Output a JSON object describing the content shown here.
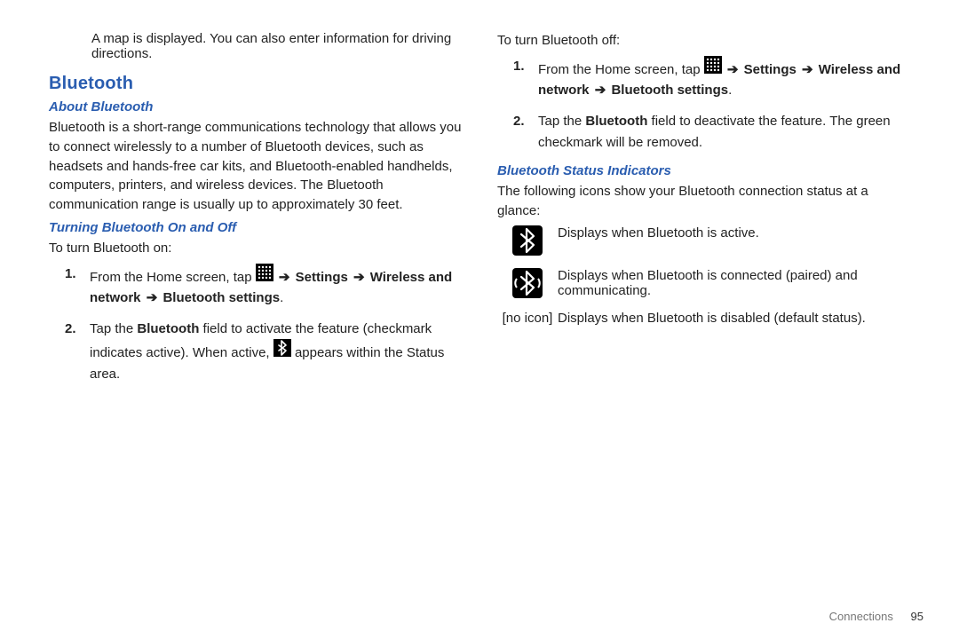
{
  "left": {
    "intro": "A map is displayed. You can also enter information for driving directions.",
    "h1": "Bluetooth",
    "about_head": "About Bluetooth",
    "about_body": "Bluetooth is a short-range communications technology that allows you to connect wirelessly to a number of Bluetooth devices, such as headsets and hands-free car kits, and Bluetooth-enabled handhelds, computers, printers, and wireless devices. The Bluetooth communication range is usually up to approximately 30 feet.",
    "toggle_head": "Turning Bluetooth On and Off",
    "on_lead": "To turn Bluetooth on:",
    "on_step1_a": "From the Home screen, tap ",
    "arrow": "➔",
    "settings": "Settings",
    "wireless": "Wireless and network",
    "bt_settings": "Bluetooth settings",
    "period": ".",
    "on_step2_a": "Tap the ",
    "bluetooth_word": "Bluetooth",
    "on_step2_b": " field to activate the feature (checkmark indicates active). When active, ",
    "on_step2_c": " appears within the Status area."
  },
  "right": {
    "off_lead": "To turn Bluetooth off:",
    "off_step1_a": "From the Home screen, tap ",
    "off_step2_a": "Tap the ",
    "off_step2_b": " field to deactivate the feature. The green checkmark will be removed.",
    "status_head": "Bluetooth Status Indicators",
    "status_intro": "The following icons show your Bluetooth connection status at a glance:",
    "row1": "Displays when Bluetooth is active.",
    "row2": "Displays when Bluetooth is connected (paired) and communicating.",
    "row3_label": "[no icon]",
    "row3": "Displays when Bluetooth is disabled (default status)."
  },
  "footer": {
    "section": "Connections",
    "page": "95"
  }
}
